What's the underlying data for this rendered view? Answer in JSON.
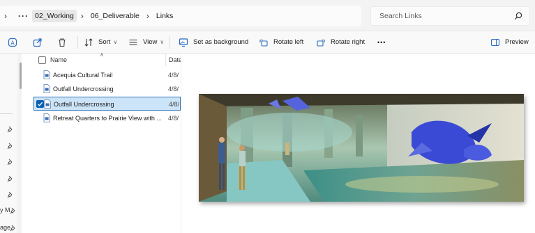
{
  "address": {
    "more": "···",
    "crumbs": [
      "02_Working",
      "06_Deliverable",
      "Links"
    ],
    "search_placeholder": "Search Links"
  },
  "toolbar": {
    "sort": "Sort",
    "view": "View",
    "set_background": "Set as background",
    "rotate_left": "Rotate left",
    "rotate_right": "Rotate right",
    "more": "•••",
    "preview": "Preview"
  },
  "nav": {
    "fragment_1": "y M",
    "fragment_2": "age"
  },
  "columns": {
    "name": "Name",
    "date": "Date"
  },
  "files": [
    {
      "name": "Acequia Cultural Trail",
      "date": "4/8/",
      "selected": false
    },
    {
      "name": "Outfall Undercrossing",
      "date": "4/8/",
      "selected": false
    },
    {
      "name": "Outfall Undercrossing",
      "date": "4/8/",
      "selected": true
    },
    {
      "name": "Retreat Quarters to Prairie View with ...",
      "date": "4/8/",
      "selected": false
    }
  ],
  "colors": {
    "accent": "#0a5fb4",
    "selection_bg": "#cce4f7",
    "selection_border": "#2e73b8"
  }
}
